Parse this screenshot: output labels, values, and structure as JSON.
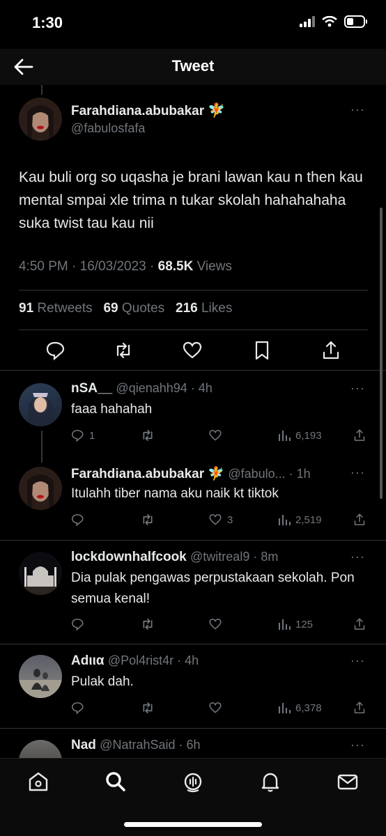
{
  "status_bar": {
    "time": "1:30"
  },
  "header": {
    "title": "Tweet"
  },
  "main_tweet": {
    "name": "Farahdiana.abubakar",
    "name_emoji": "🧚",
    "handle": "@fabulosfafa",
    "text": "Kau buli org so uqasha je brani lawan kau n then kau mental smpai xle trima n tukar skolah hahahahaha suka twist tau kau nii",
    "time": "4:50 PM · 16/03/2023 · ",
    "views_count": "68.5K",
    "views_label": " Views",
    "retweets_count": "91",
    "retweets_label": " Retweets",
    "quotes_count": "69",
    "quotes_label": " Quotes",
    "likes_count": "216",
    "likes_label": " Likes"
  },
  "replies": [
    {
      "name": "nSA__",
      "handle": "@qienahh94 · 4h",
      "text": "faaa hahahah",
      "reply_count": "1",
      "like_count": "",
      "views": "6,193"
    },
    {
      "name": "Farahdiana.abubakar",
      "name_emoji": "🧚",
      "handle": "@fabulo... · 1h",
      "text": "Itulahh tiber nama aku naik kt tiktok",
      "reply_count": "",
      "like_count": "3",
      "views": "2,519"
    },
    {
      "name": "lockdownhalfcook",
      "handle": "@twitreal9 · 8m",
      "text": "Dia pulak pengawas perpustakaan sekolah. Pon semua kenal!",
      "reply_count": "",
      "like_count": "",
      "views": "125"
    },
    {
      "name": "Adιια",
      "handle": "@Pol4rist4r · 4h",
      "text": "Pulak dah.",
      "reply_count": "",
      "like_count": "",
      "views": "6,378"
    },
    {
      "name": "Nad",
      "handle": "@NatrahSaid · 6h",
      "text": "",
      "reply_count": "",
      "like_count": "",
      "views": ""
    }
  ],
  "more_glyph": "···",
  "colors": {
    "background": "#000000",
    "text": "#e7e9ea",
    "muted": "#71767b",
    "divider": "#2f3336"
  },
  "icons": [
    "back-arrow-icon",
    "reply-icon",
    "retweet-icon",
    "like-icon",
    "bookmark-icon",
    "share-icon",
    "views-icon",
    "home-icon",
    "search-icon",
    "spaces-icon",
    "notifications-icon",
    "messages-icon"
  ]
}
